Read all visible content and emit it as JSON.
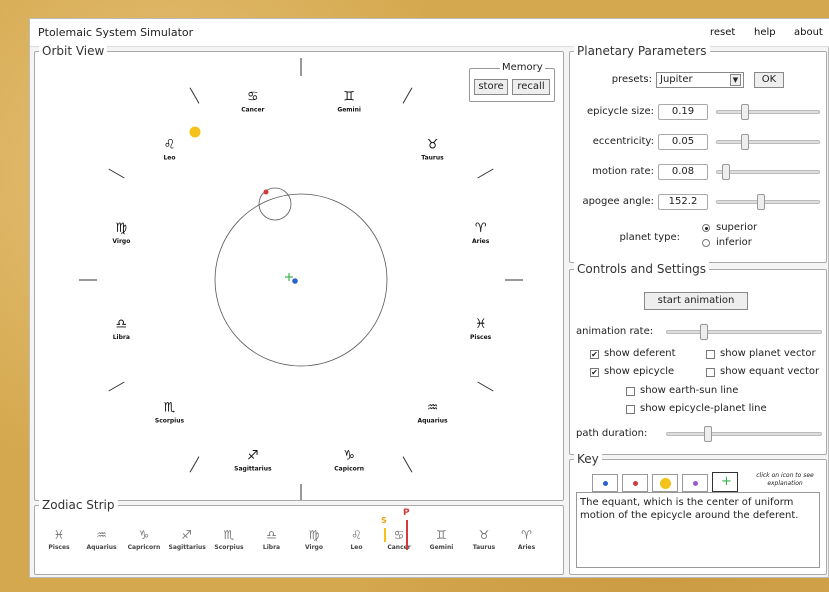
{
  "titlebar": {
    "title": "Ptolemaic System Simulator",
    "links": [
      "reset",
      "help",
      "about"
    ]
  },
  "orbit_view": {
    "title": "Orbit View",
    "memory": {
      "title": "Memory",
      "store_label": "store",
      "recall_label": "recall"
    },
    "signs": [
      {
        "glyph": "♋",
        "name": "Cancer"
      },
      {
        "glyph": "♊",
        "name": "Gemini"
      },
      {
        "glyph": "♉",
        "name": "Taurus"
      },
      {
        "glyph": "♈",
        "name": "Aries"
      },
      {
        "glyph": "♓",
        "name": "Pisces"
      },
      {
        "glyph": "♒",
        "name": "Aquarius"
      },
      {
        "glyph": "♑",
        "name": "Capicorn"
      },
      {
        "glyph": "♐",
        "name": "Sagittarius"
      },
      {
        "glyph": "♏",
        "name": "Scorpius"
      },
      {
        "glyph": "♎",
        "name": "Libra"
      },
      {
        "glyph": "♍",
        "name": "Virgo"
      },
      {
        "glyph": "♌",
        "name": "Leo"
      }
    ],
    "colors": {
      "sun": "#f5c21b",
      "planet": "#d23b3b",
      "earth": "#2a63c9",
      "equant": "#3bb54a"
    }
  },
  "planetary_parameters": {
    "title": "Planetary Parameters",
    "presets_label": "presets:",
    "preset_value": "Jupiter",
    "ok_label": "OK",
    "params": [
      {
        "label": "epicycle size:",
        "value": "0.19",
        "level": 0.25
      },
      {
        "label": "eccentricity:",
        "value": "0.05",
        "level": 0.25
      },
      {
        "label": "motion rate:",
        "value": "0.08",
        "level": 0.05
      },
      {
        "label": "apogee angle:",
        "value": "152.2",
        "level": 0.42
      }
    ],
    "planet_type_label": "planet type:",
    "planet_types": [
      "superior",
      "inferior"
    ],
    "planet_type_selected": "superior"
  },
  "controls": {
    "title": "Controls and Settings",
    "start_label": "start animation",
    "animation_rate_label": "animation rate:",
    "animation_rate_level": 0.22,
    "checks": [
      {
        "label": "show deferent",
        "checked": true
      },
      {
        "label": "show planet vector",
        "checked": false
      },
      {
        "label": "show epicycle",
        "checked": true
      },
      {
        "label": "show equant vector",
        "checked": false
      },
      {
        "label": "show earth-sun line",
        "checked": false
      },
      {
        "label": "show epicycle-planet line",
        "checked": false
      }
    ],
    "path_duration_label": "path duration:",
    "path_duration_level": 0.25
  },
  "key": {
    "title": "Key",
    "hint": "click on icon to see explanation",
    "explanation": "The equant, which is the center of uniform motion of the epicycle around the deferent.",
    "icons": [
      {
        "name": "earth",
        "color": "#2a63c9"
      },
      {
        "name": "planet",
        "color": "#d23b3b"
      },
      {
        "name": "sun",
        "color": "#f5c21b"
      },
      {
        "name": "epicycle-center",
        "color": "#9b59d0"
      },
      {
        "name": "equant",
        "color": "#3bb54a"
      }
    ]
  },
  "zodiac_strip": {
    "title": "Zodiac Strip",
    "sun_marker": "S",
    "planet_marker": "P",
    "signs": [
      {
        "glyph": "♓",
        "name": "Pisces"
      },
      {
        "glyph": "♒",
        "name": "Aquarius"
      },
      {
        "glyph": "♑",
        "name": "Capricorn"
      },
      {
        "glyph": "♐",
        "name": "Sagittarius"
      },
      {
        "glyph": "♏",
        "name": "Scorpius"
      },
      {
        "glyph": "♎",
        "name": "Libra"
      },
      {
        "glyph": "♍",
        "name": "Virgo"
      },
      {
        "glyph": "♌",
        "name": "Leo"
      },
      {
        "glyph": "♋",
        "name": "Cancer"
      },
      {
        "glyph": "♊",
        "name": "Gemini"
      },
      {
        "glyph": "♉",
        "name": "Taurus"
      },
      {
        "glyph": "♈",
        "name": "Aries"
      }
    ]
  }
}
